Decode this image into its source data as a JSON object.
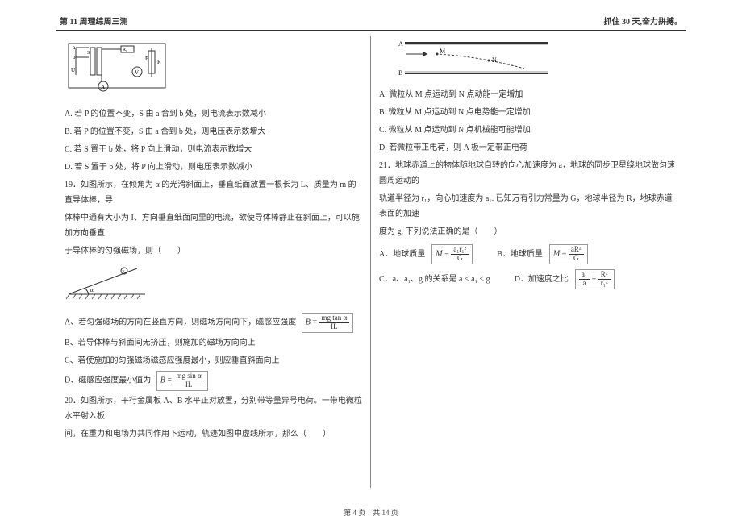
{
  "header": {
    "left": "第 11 周理综周三测",
    "right_prefix": "抓住 ",
    "right_days": "30",
    "right_suffix": " 天,奋力拼搏。"
  },
  "left_col": {
    "optA": "A. 若 P 的位置不变，S 由 a 合到 b 处，则电流表示数减小",
    "optB": "B. 若 P 的位置不变，S 由 a 合到 b 处，则电压表示数增大",
    "optC": "C. 若 S 置于 b 处，将 P 向上滑动，则电流表示数增大",
    "optD": "D. 若 S 置于 b 处，将 P 向上滑动，则电压表示数减小",
    "q19_1": "19．如图所示，在倾角为 α 的光滑斜面上，垂直纸面放置一根长为 L、质量为 m 的直导体棒，导",
    "q19_2": "体棒中通有大小为 I、方向垂直纸面向里的电流，欲使导体棒静止在斜面上，可以施加方向垂直",
    "q19_3": "于导体棒的匀强磁场，则（　　）",
    "q19_A_pre": "A、若匀强磁场的方向在竖直方向，则磁场方向向下，磁感应强度",
    "q19_A_formula_num": "mg tan α",
    "q19_A_formula_den": "IL",
    "q19_B": "B、若导体棒与斜面间无挤压，则施加的磁场方向向上",
    "q19_C": "C、若使施加的匀强磁场磁感应强度最小，则应垂直斜面向上",
    "q19_D_pre": "D、磁感应强度最小值为",
    "q19_D_formula_num": "mg sin α",
    "q19_D_formula_den": "IL",
    "q20_1": "20．如图所示，平行金属板 A、B 水平正对放置，分别带等量异号电荷。一带电微粒水平射入板",
    "q20_2": "间，在重力和电场力共同作用下运动，轨迹如图中虚线所示，那么（　　）"
  },
  "right_col": {
    "optA": "A. 微粒从 M 点运动到 N 点动能一定增加",
    "optB": "B. 微粒从 M 点运动到 N 点电势能一定增加",
    "optC": "C. 微粒从 M 点运动到 N 点机械能可能增加",
    "optD": "D. 若微粒带正电荷，则 A 板一定带正电荷",
    "q21_1": "21．地球赤道上的物体随地球自转的向心加速度为 a，地球的同步卫星绕地球做匀速圆周运动的",
    "q21_2": "轨道半径为 r₁，向心加速度为 a₁. 已知万有引力常量为 G，地球半径为 R，地球赤道表面的加速",
    "q21_3": "度为 g. 下列说法正确的是（　　）",
    "optA21_lbl": "A．地球质量",
    "optA21_num": "a₁r₁²",
    "optA21_den": "G",
    "optB21_lbl": "B．地球质量",
    "optB21_num": "aR²",
    "optB21_den": "G",
    "optC21": "C．a、a₁、g 的关系是 a < a₁ < g",
    "optD21_lbl": "D．加速度之比",
    "optD21_left_num": "a₁",
    "optD21_left_den": "a",
    "optD21_right_num": "R²",
    "optD21_right_den": "r₁²"
  },
  "footer": {
    "text": "第 4 页　共 14 页"
  }
}
